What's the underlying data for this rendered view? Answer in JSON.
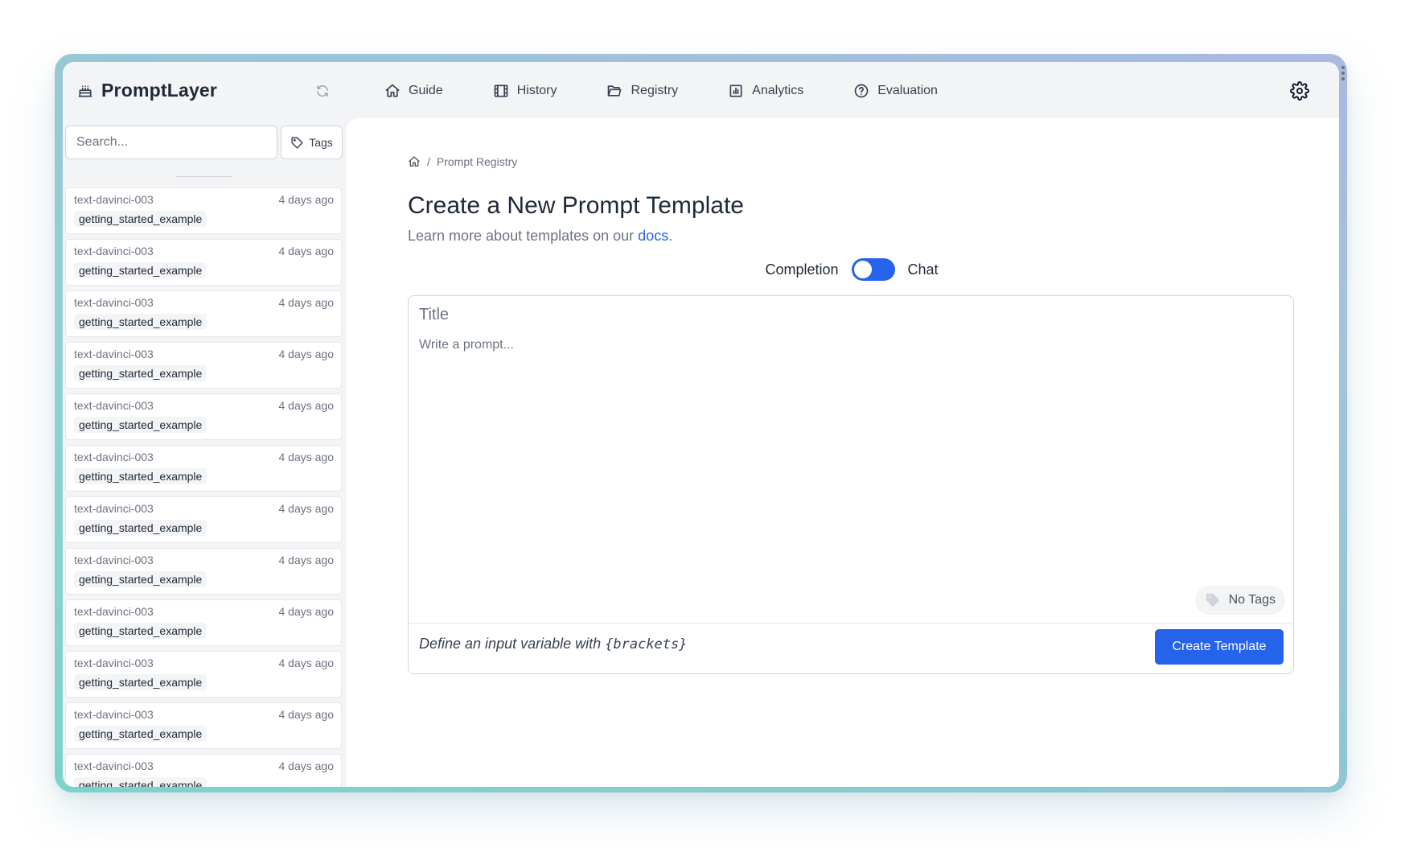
{
  "app": {
    "name": "PromptLayer"
  },
  "nav": [
    {
      "label": "Guide",
      "icon": "home-icon"
    },
    {
      "label": "History",
      "icon": "film-icon"
    },
    {
      "label": "Registry",
      "icon": "folder-open-icon"
    },
    {
      "label": "Analytics",
      "icon": "bar-chart-icon"
    },
    {
      "label": "Evaluation",
      "icon": "help-circle-icon"
    }
  ],
  "sidebar": {
    "search_placeholder": "Search...",
    "tags_label": "Tags",
    "items": [
      {
        "model": "text-davinci-003",
        "time": "4 days ago",
        "tag": "getting_started_example"
      },
      {
        "model": "text-davinci-003",
        "time": "4 days ago",
        "tag": "getting_started_example"
      },
      {
        "model": "text-davinci-003",
        "time": "4 days ago",
        "tag": "getting_started_example"
      },
      {
        "model": "text-davinci-003",
        "time": "4 days ago",
        "tag": "getting_started_example"
      },
      {
        "model": "text-davinci-003",
        "time": "4 days ago",
        "tag": "getting_started_example"
      },
      {
        "model": "text-davinci-003",
        "time": "4 days ago",
        "tag": "getting_started_example"
      },
      {
        "model": "text-davinci-003",
        "time": "4 days ago",
        "tag": "getting_started_example"
      },
      {
        "model": "text-davinci-003",
        "time": "4 days ago",
        "tag": "getting_started_example"
      },
      {
        "model": "text-davinci-003",
        "time": "4 days ago",
        "tag": "getting_started_example"
      },
      {
        "model": "text-davinci-003",
        "time": "4 days ago",
        "tag": "getting_started_example"
      },
      {
        "model": "text-davinci-003",
        "time": "4 days ago",
        "tag": "getting_started_example"
      },
      {
        "model": "text-davinci-003",
        "time": "4 days ago",
        "tag": "getting_started_example"
      }
    ]
  },
  "main": {
    "breadcrumb_sep": "/",
    "breadcrumb": "Prompt Registry",
    "title": "Create a New Prompt Template",
    "subtitle_prefix": "Learn more about templates on our ",
    "subtitle_link": "docs",
    "subtitle_suffix": ".",
    "mode_left": "Completion",
    "mode_right": "Chat",
    "title_placeholder": "Title",
    "prompt_placeholder": "Write a prompt...",
    "no_tags_label": "No Tags",
    "hint_prefix": "Define an input variable with ",
    "hint_code": "{brackets}",
    "create_button": "Create Template"
  },
  "colors": {
    "accent": "#2563eb",
    "text": "#1f2937",
    "muted": "#6b7280"
  }
}
